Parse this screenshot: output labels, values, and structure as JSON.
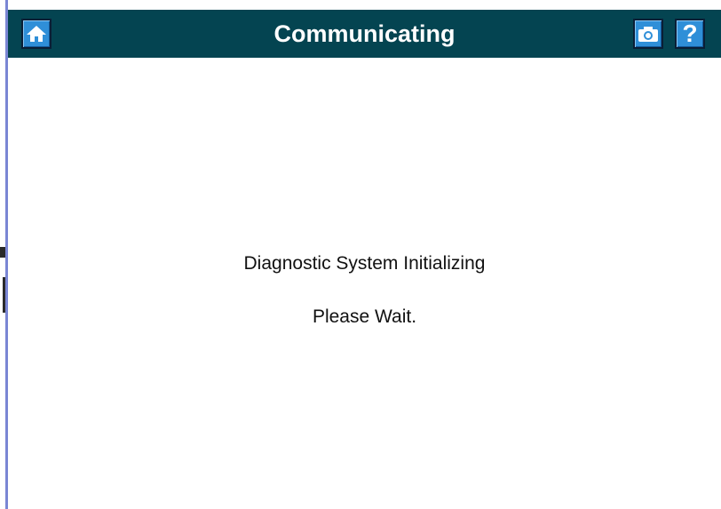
{
  "header": {
    "title": "Communicating",
    "home_button_icon": "home-icon",
    "camera_button_icon": "camera-icon",
    "help_button_icon": "help-icon",
    "help_glyph": "?"
  },
  "main": {
    "status_message": "Diagnostic System Initializing",
    "wait_message": "Please Wait."
  },
  "colors": {
    "title_bar": "#044451",
    "button_fill": "#2f8fd8",
    "left_stripe": "#7a86d4",
    "background": "#ffffff"
  }
}
